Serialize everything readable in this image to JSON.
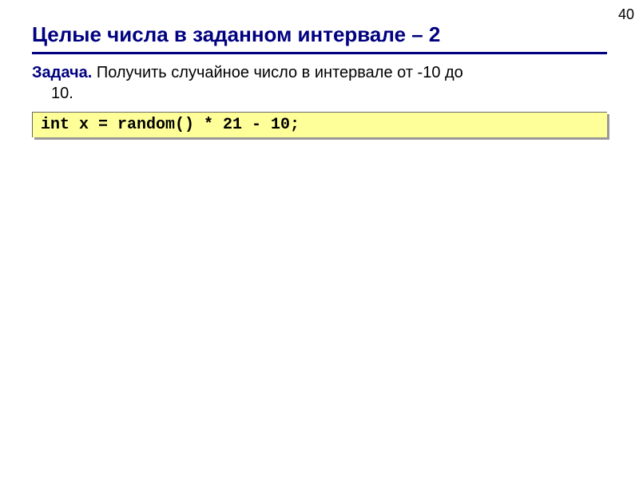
{
  "pageNumber": "40",
  "title": "Целые числа в заданном интервале – 2",
  "task": {
    "label": "Задача.",
    "line1": " Получить случайное число в интервале от -10 до",
    "line2": "10."
  },
  "code": "int x = random() * 21 - 10;"
}
